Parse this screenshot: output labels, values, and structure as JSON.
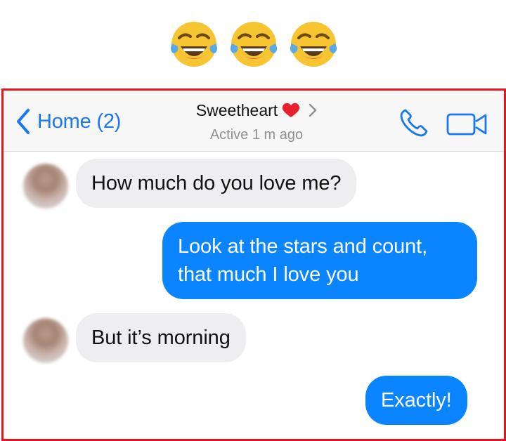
{
  "emojis": [
    "face-with-tears-of-joy-icon",
    "face-with-tears-of-joy-icon",
    "face-with-tears-of-joy-icon"
  ],
  "header": {
    "back_label": "Home (2)",
    "contact_name": "Sweetheart",
    "status": "Active 1 m ago"
  },
  "messages": [
    {
      "from": "them",
      "text": "How much do you love me?"
    },
    {
      "from": "me",
      "lines": [
        "Look at the stars and count,",
        "that much I love you"
      ]
    },
    {
      "from": "them",
      "text": "But it’s morning"
    },
    {
      "from": "me",
      "text": "Exactly!"
    }
  ],
  "colors": {
    "frame": "#e3151f",
    "accent": "#1a77f2",
    "outgoing_bubble": "#0a84ff",
    "incoming_bubble": "#eeeef0",
    "heart": "#e8202e"
  }
}
